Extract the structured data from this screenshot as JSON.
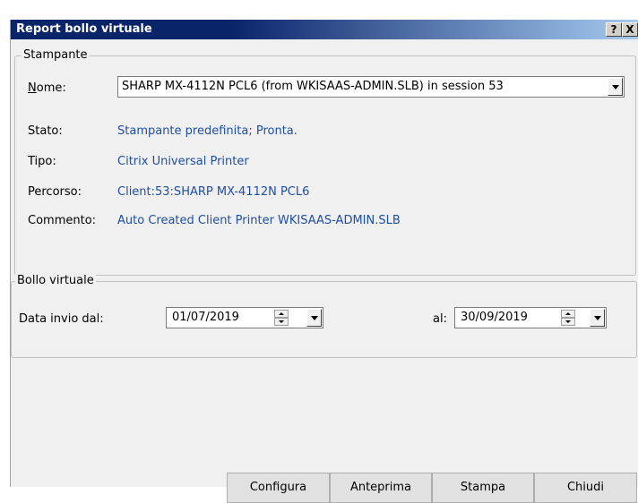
{
  "window": {
    "title": "Report bollo virtuale",
    "help_label": "?",
    "close_label": "X"
  },
  "stampante": {
    "legend": "Stampante",
    "nome_label": "Nome:",
    "nome_value": "SHARP MX-4112N PCL6 (from WKISAAS-ADMIN.SLB) in session 53",
    "stato_label": "Stato:",
    "stato_value": "Stampante predefinita; Pronta.",
    "tipo_label": "Tipo:",
    "tipo_value": "Citrix Universal Printer",
    "percorso_label": "Percorso:",
    "percorso_value": "Client:53:SHARP MX-4112N PCL6",
    "commento_label": "Commento:",
    "commento_value": "Auto Created Client Printer WKISAAS-ADMIN.SLB"
  },
  "bollo": {
    "legend": "Bollo virtuale",
    "data_dal_label": "Data invio dal:",
    "data_dal_value": "01/07/2019",
    "al_label": "al:",
    "data_al_value": "30/09/2019"
  },
  "buttons": {
    "configura": "Configura",
    "anteprima": "Anteprima",
    "stampa": "Stampa",
    "chiudi": "Chiudi"
  }
}
